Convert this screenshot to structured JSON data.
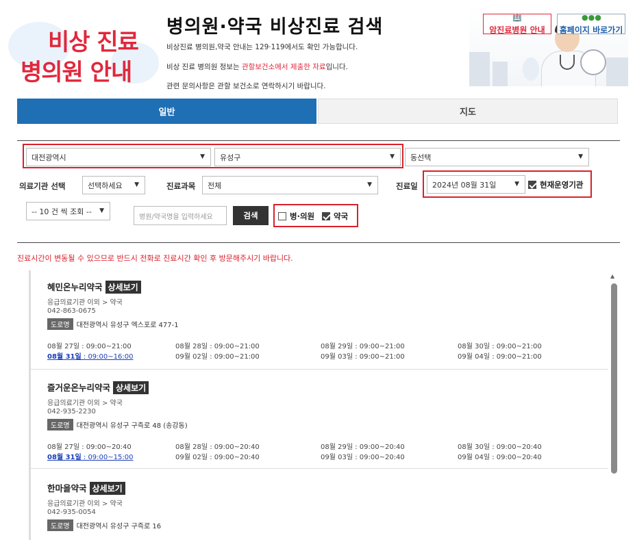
{
  "header": {
    "logo_line1": "비상 진료",
    "logo_line2": "병의원 안내",
    "title": "병의원·약국 비상진료 검색",
    "info1": "비상진료 병의원,약국 안내는 129·119에서도 확인 가능합니다.",
    "info2_pre": "비상 진료 병의원 정보는 ",
    "info2_red": "관할보건소에서 제출한 자료",
    "info2_post": "입니다.",
    "info3": "관련 문의사항은 관할 보건소로 연락하시기 바랍니다.",
    "banner_btn1": "암진료병원 안내",
    "banner_btn2": "홈페이지 바로가기"
  },
  "tabs": {
    "general": "일반",
    "map": "지도"
  },
  "filter": {
    "city": "대전광역시",
    "district": "유성구",
    "dong": "동선택",
    "facility_label": "의료기관 선택",
    "facility_value": "선택하세요",
    "dept_label": "진료과목",
    "dept_value": "전체",
    "date_label": "진료일",
    "date_value": "2024년 08월 31일",
    "current_open_label": "현재운영기관",
    "page_size": "-- 10 건 씩 조회 --",
    "search_placeholder": "병원/약국명을 입력하세요",
    "search_button": "검색",
    "clinic_label": "병·의원",
    "pharmacy_label": "약국"
  },
  "notice": "진료시간이 변동될 수 있으므로 반드시 전화로 진료시간 확인 후 방문해주시기 바랍니다.",
  "results": [
    {
      "name": "혜민온누리약국",
      "detail": "상세보기",
      "category": "응급의료기관 이외 > 약국",
      "phone": "042-863-0675",
      "road_tag": "도로명",
      "address": "대전광역시 유성구 엑스포로 477-1",
      "hours": [
        "08월 27일 : 09:00~21:00",
        "08월 28일 : 09:00~21:00",
        "08월 29일 : 09:00~21:00",
        "08월 30일 : 09:00~21:00",
        "08월 31일 : 09:00~16:00",
        "09월 02일 : 09:00~21:00",
        "09월 03일 : 09:00~21:00",
        "09월 04일 : 09:00~21:00"
      ]
    },
    {
      "name": "즐거운온누리약국",
      "detail": "상세보기",
      "category": "응급의료기관 이외 > 약국",
      "phone": "042-935-2230",
      "road_tag": "도로명",
      "address": "대전광역시 유성구 구즉로 48 (송강동)",
      "hours": [
        "08월 27일 : 09:00~20:40",
        "08월 28일 : 09:00~20:40",
        "08월 29일 : 09:00~20:40",
        "08월 30일 : 09:00~20:40",
        "08월 31일 : 09:00~15:00",
        "09월 02일 : 09:00~20:40",
        "09월 03일 : 09:00~20:40",
        "09월 04일 : 09:00~20:40"
      ]
    },
    {
      "name": "한마을약국",
      "detail": "상세보기",
      "category": "응급의료기관 이외 > 약국",
      "phone": "042-935-0054",
      "road_tag": "도로명",
      "address": "대전광역시 유성구 구즉로 16",
      "hours": []
    }
  ],
  "today_label_1": "08월 31일",
  "today_hours_1": " : 09:00~16:00",
  "today_label_2": "08월 31일",
  "today_hours_2": " : 09:00~15:00",
  "colors": {
    "accent": "#1f6fb5",
    "highlight": "#d9202a",
    "dark_button": "#333333"
  },
  "icons": [
    "chevron-down-icon",
    "checkbox-checked-icon",
    "checkbox-empty-icon",
    "scroll-up-icon"
  ]
}
